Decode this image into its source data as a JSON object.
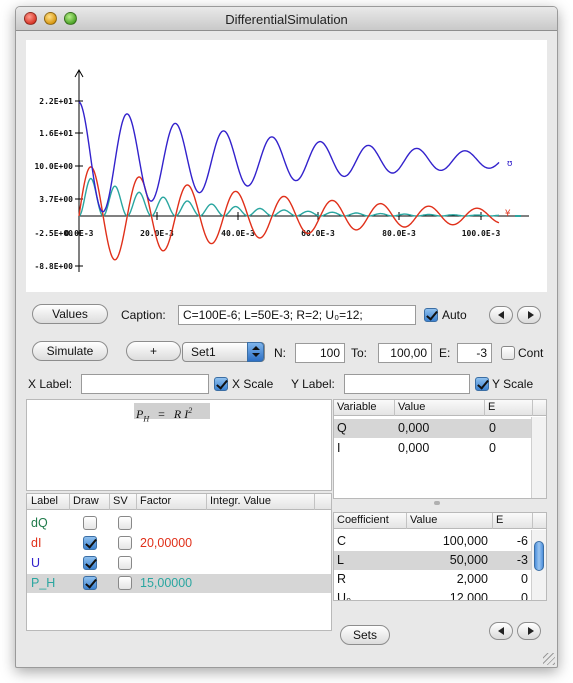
{
  "window": {
    "title": "DifferentialSimulation"
  },
  "plot": {
    "y_ticks": [
      "2.2E+01",
      "1.6E+01",
      "10.0E+00",
      "3.7E+00",
      "-2.5E+00",
      "-8.8E+00"
    ],
    "x_ticks": [
      "0.0E-3",
      "20.0E-3",
      "40.0E-3",
      "60.0E-3",
      "80.0E-3",
      "100.0E-3"
    ],
    "colors": {
      "U": "#3322cc",
      "dI": "#e0301a",
      "P_H": "#2aa6a0"
    }
  },
  "controls": {
    "values_button": "Values",
    "caption_label": "Caption:",
    "caption_value": "C=100E-6; L=50E-3; R=2; U₀=12;",
    "auto_label": "Auto",
    "simulate_button": "Simulate",
    "add_button": "+",
    "set_select": "Set1",
    "n_label": "N:",
    "n_value": "100",
    "to_label": "To:",
    "to_value": "100,00",
    "e_label": "E:",
    "e_value": "-3",
    "cont_label": "Cont",
    "xlabel_label": "X Label:",
    "xlabel_value": "",
    "xscale_label": "X Scale",
    "ylabel_label": "Y Label:",
    "ylabel_value": "",
    "yscale_label": "Y Scale"
  },
  "formula": "P_H = R I²",
  "formula_parts": {
    "lhs": "P",
    "sub": "H",
    "eq": "=",
    "rhs": "R I",
    "sup": "2"
  },
  "series_table": {
    "headers": [
      "Label",
      "Draw",
      "SV",
      "Factor",
      "Integr. Value"
    ],
    "rows": [
      {
        "label": "dQ",
        "draw": false,
        "sv": false,
        "factor": "",
        "color": "#1f7a4a"
      },
      {
        "label": "dI",
        "draw": true,
        "sv": false,
        "factor": "20,00000",
        "color": "#e0301a"
      },
      {
        "label": "U",
        "draw": true,
        "sv": false,
        "factor": "",
        "color": "#3322cc"
      },
      {
        "label": "P_H",
        "draw": true,
        "sv": false,
        "factor": "15,00000",
        "color": "#2aa6a0"
      }
    ]
  },
  "variable_table": {
    "headers": [
      "Variable",
      "Value",
      "E"
    ],
    "rows": [
      {
        "name": "Q",
        "value": "0,000",
        "e": "0"
      },
      {
        "name": "I",
        "value": "0,000",
        "e": "0"
      }
    ]
  },
  "coefficient_table": {
    "headers": [
      "Coefficient",
      "Value",
      "E"
    ],
    "rows": [
      {
        "name": "C",
        "value": "100,000",
        "e": "-6"
      },
      {
        "name": "L",
        "value": "50,000",
        "e": "-3"
      },
      {
        "name": "R",
        "value": "2,000",
        "e": "0"
      },
      {
        "name": "U₀",
        "value": "12,000",
        "e": "0"
      }
    ]
  },
  "sets_button": "Sets"
}
